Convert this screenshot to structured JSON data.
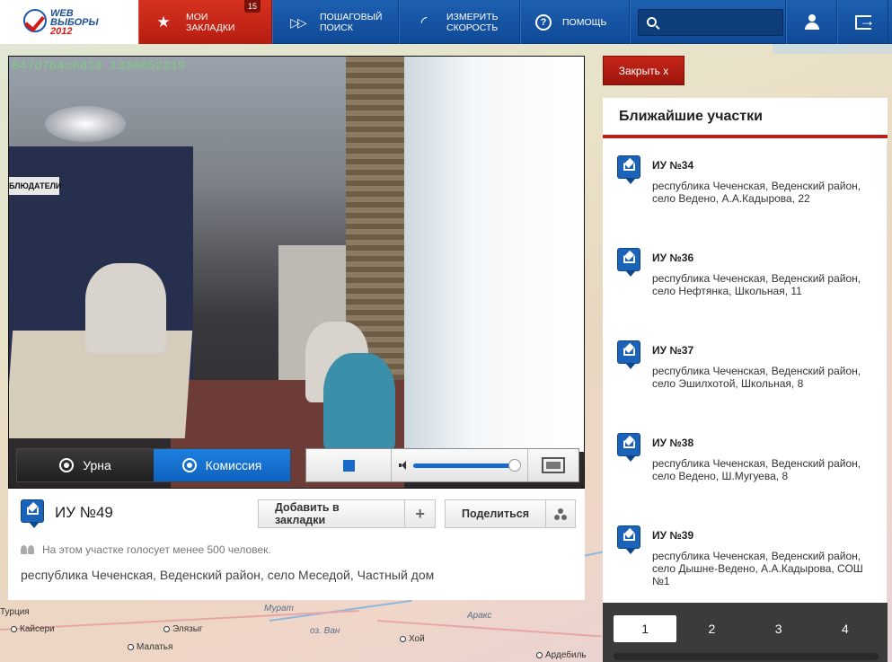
{
  "brand": {
    "line1": "WEB",
    "line2": "ВЫБОРЫ",
    "year": "2012"
  },
  "nav": {
    "bookmarks": {
      "label_line1": "МОИ",
      "label_line2": "ЗАКЛАДКИ",
      "count": "15"
    },
    "step_search": {
      "label_line1": "ПОШАГОВЫЙ",
      "label_line2": "ПОИСК"
    },
    "speed": {
      "label_line1": "ИЗМЕРИТЬ",
      "label_line2": "СКОРОСТЬ"
    },
    "help": {
      "label": "ПОМОЩЬ",
      "icon_glyph": "?"
    },
    "search": {
      "value": "",
      "placeholder": ""
    }
  },
  "map": {
    "cities": [
      "Кайсери",
      "Элязыг",
      "Малатья",
      "Хой",
      "Ардебиль"
    ],
    "labels": [
      "Мурат",
      "оз. Ван",
      "Аракс",
      "Турция"
    ]
  },
  "video": {
    "camera_id": "047d7b4c6d18 1330852319",
    "banner_sign": "БЛЮДАТЕЛИ",
    "tabs": [
      {
        "label": "Урна",
        "active": false
      },
      {
        "label": "Комиссия",
        "active": true
      }
    ],
    "volume_level": 0.95
  },
  "station": {
    "title": "ИУ №49",
    "add_bookmark": "Добавить в закладки",
    "add_icon": "+",
    "share": "Поделиться",
    "note": "На этом участке голосует менее 500 человек.",
    "address": "республика Чеченская, Веденский район, село Меседой, Частный дом"
  },
  "close_button": "Закрыть  x",
  "nearby": {
    "title": "Ближайшие участки",
    "items": [
      {
        "name": "ИУ №34",
        "address": "республика Чеченская, Веденский район, село Ведено, А.А.Кадырова, 22"
      },
      {
        "name": "ИУ №36",
        "address": "республика Чеченская, Веденский район, село Нефтянка, Школьная, 11"
      },
      {
        "name": "ИУ №37",
        "address": "республика Чеченская, Веденский район, село Эшилхотой, Школьная, 8"
      },
      {
        "name": "ИУ №38",
        "address": "республика Чеченская, Веденский район, село Ведено, Ш.Мугуева, 8"
      },
      {
        "name": "ИУ №39",
        "address": "республика Чеченская, Веденский район, село Дышне-Ведено, А.А.Кадырова, СОШ №1"
      }
    ],
    "pages": [
      "1",
      "2",
      "3",
      "4"
    ],
    "active_page": "1"
  },
  "colors": {
    "nav_blue": "#1d5fb0",
    "accent_red": "#c7261a",
    "active_tab_blue": "#1d7fe0"
  }
}
